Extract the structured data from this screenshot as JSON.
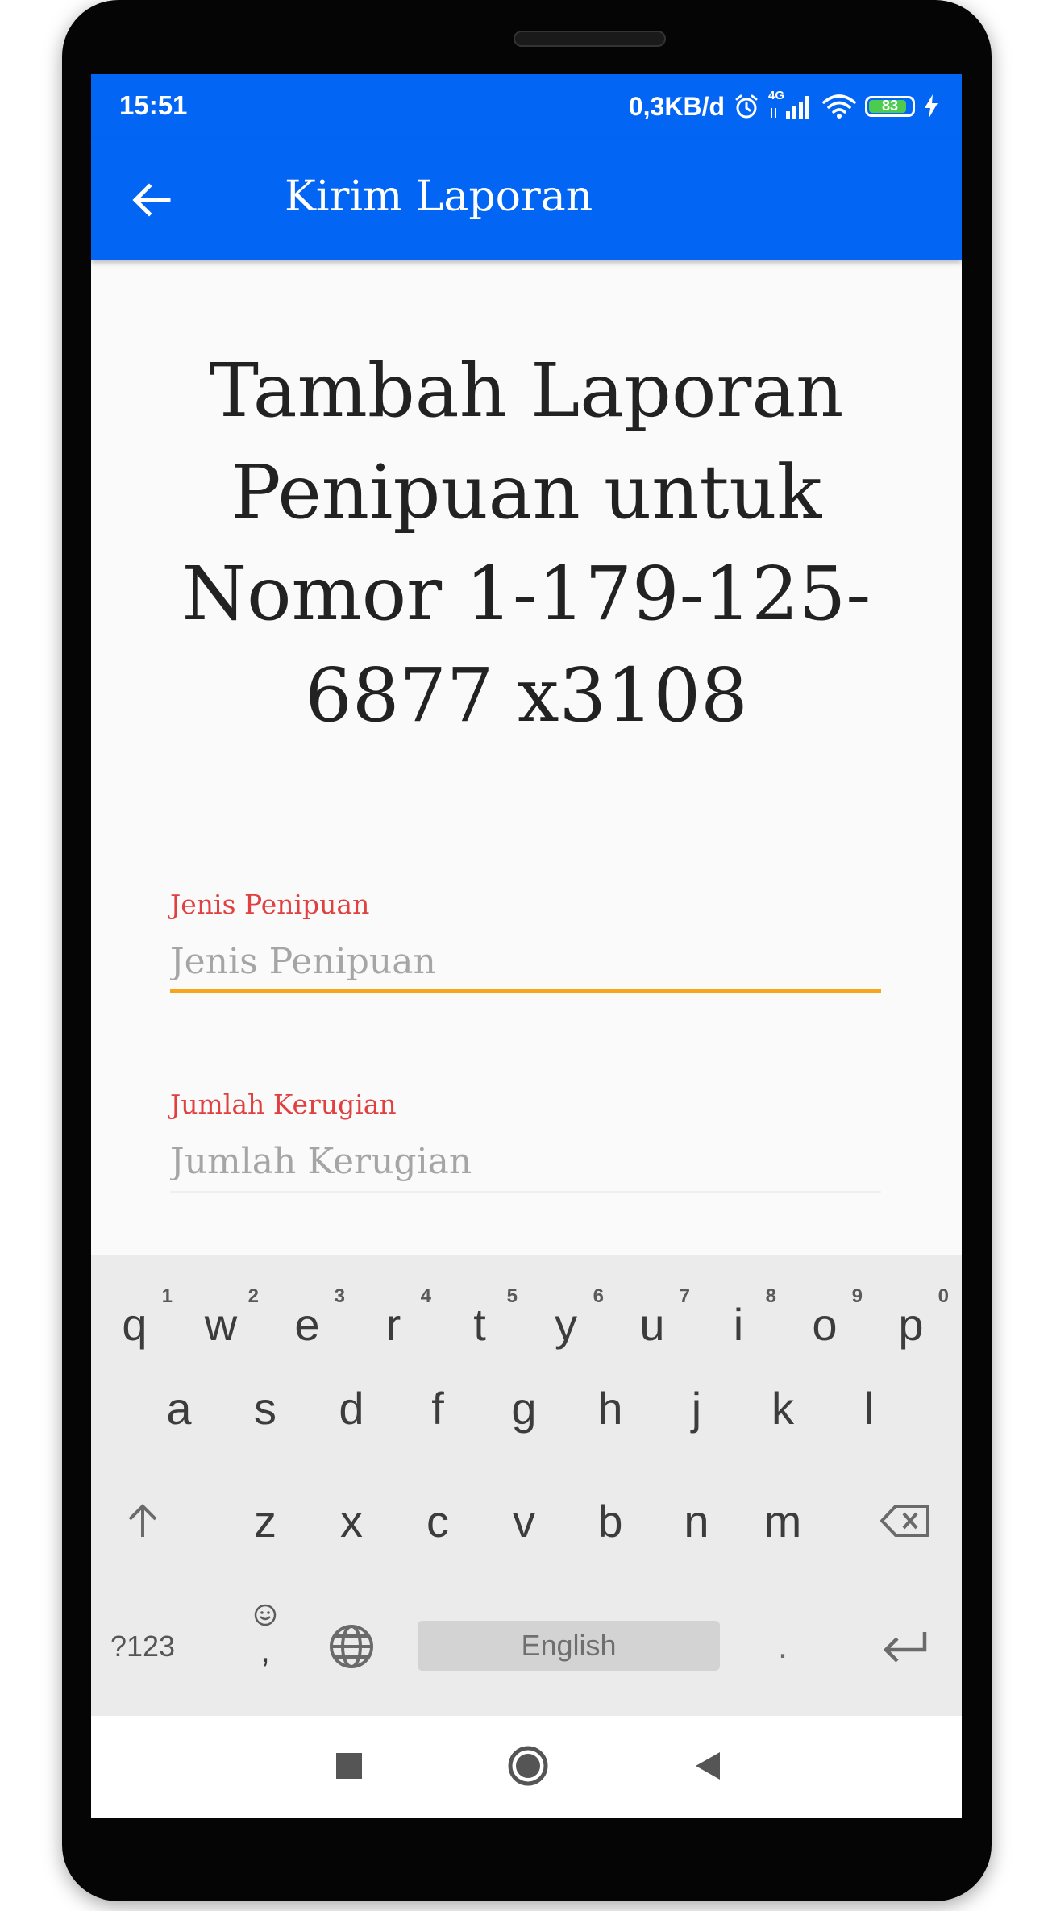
{
  "status_bar": {
    "time": "15:51",
    "net_speed": "0,3KB/d",
    "network_type": "4G",
    "battery_level": "83",
    "icons": [
      "alarm-icon",
      "signal-icon",
      "wifi-icon",
      "battery-icon",
      "charging-icon"
    ]
  },
  "app_bar": {
    "title": "Kirim Laporan",
    "back_icon": "arrow-back-icon"
  },
  "main": {
    "heading": "Tambah Laporan Penipuan untuk Nomor 1-179-125-6877 x3108",
    "fields": [
      {
        "label": "Jenis Penipuan",
        "placeholder": "Jenis Penipuan",
        "value": ""
      },
      {
        "label": "Jumlah Kerugian",
        "placeholder": "Jumlah Kerugian",
        "value": ""
      }
    ]
  },
  "keyboard": {
    "row1": [
      {
        "key": "q",
        "hint": "1"
      },
      {
        "key": "w",
        "hint": "2"
      },
      {
        "key": "e",
        "hint": "3"
      },
      {
        "key": "r",
        "hint": "4"
      },
      {
        "key": "t",
        "hint": "5"
      },
      {
        "key": "y",
        "hint": "6"
      },
      {
        "key": "u",
        "hint": "7"
      },
      {
        "key": "i",
        "hint": "8"
      },
      {
        "key": "o",
        "hint": "9"
      },
      {
        "key": "p",
        "hint": "0"
      }
    ],
    "row2": [
      "a",
      "s",
      "d",
      "f",
      "g",
      "h",
      "j",
      "k",
      "l"
    ],
    "row3": [
      "z",
      "x",
      "c",
      "v",
      "b",
      "n",
      "m"
    ],
    "symbols_label": "?123",
    "comma_label": ",",
    "period_label": ".",
    "space_label": "English"
  },
  "colors": {
    "primary": "#0365f3",
    "label": "#e0403f",
    "focus_underline": "#f8a51b"
  }
}
